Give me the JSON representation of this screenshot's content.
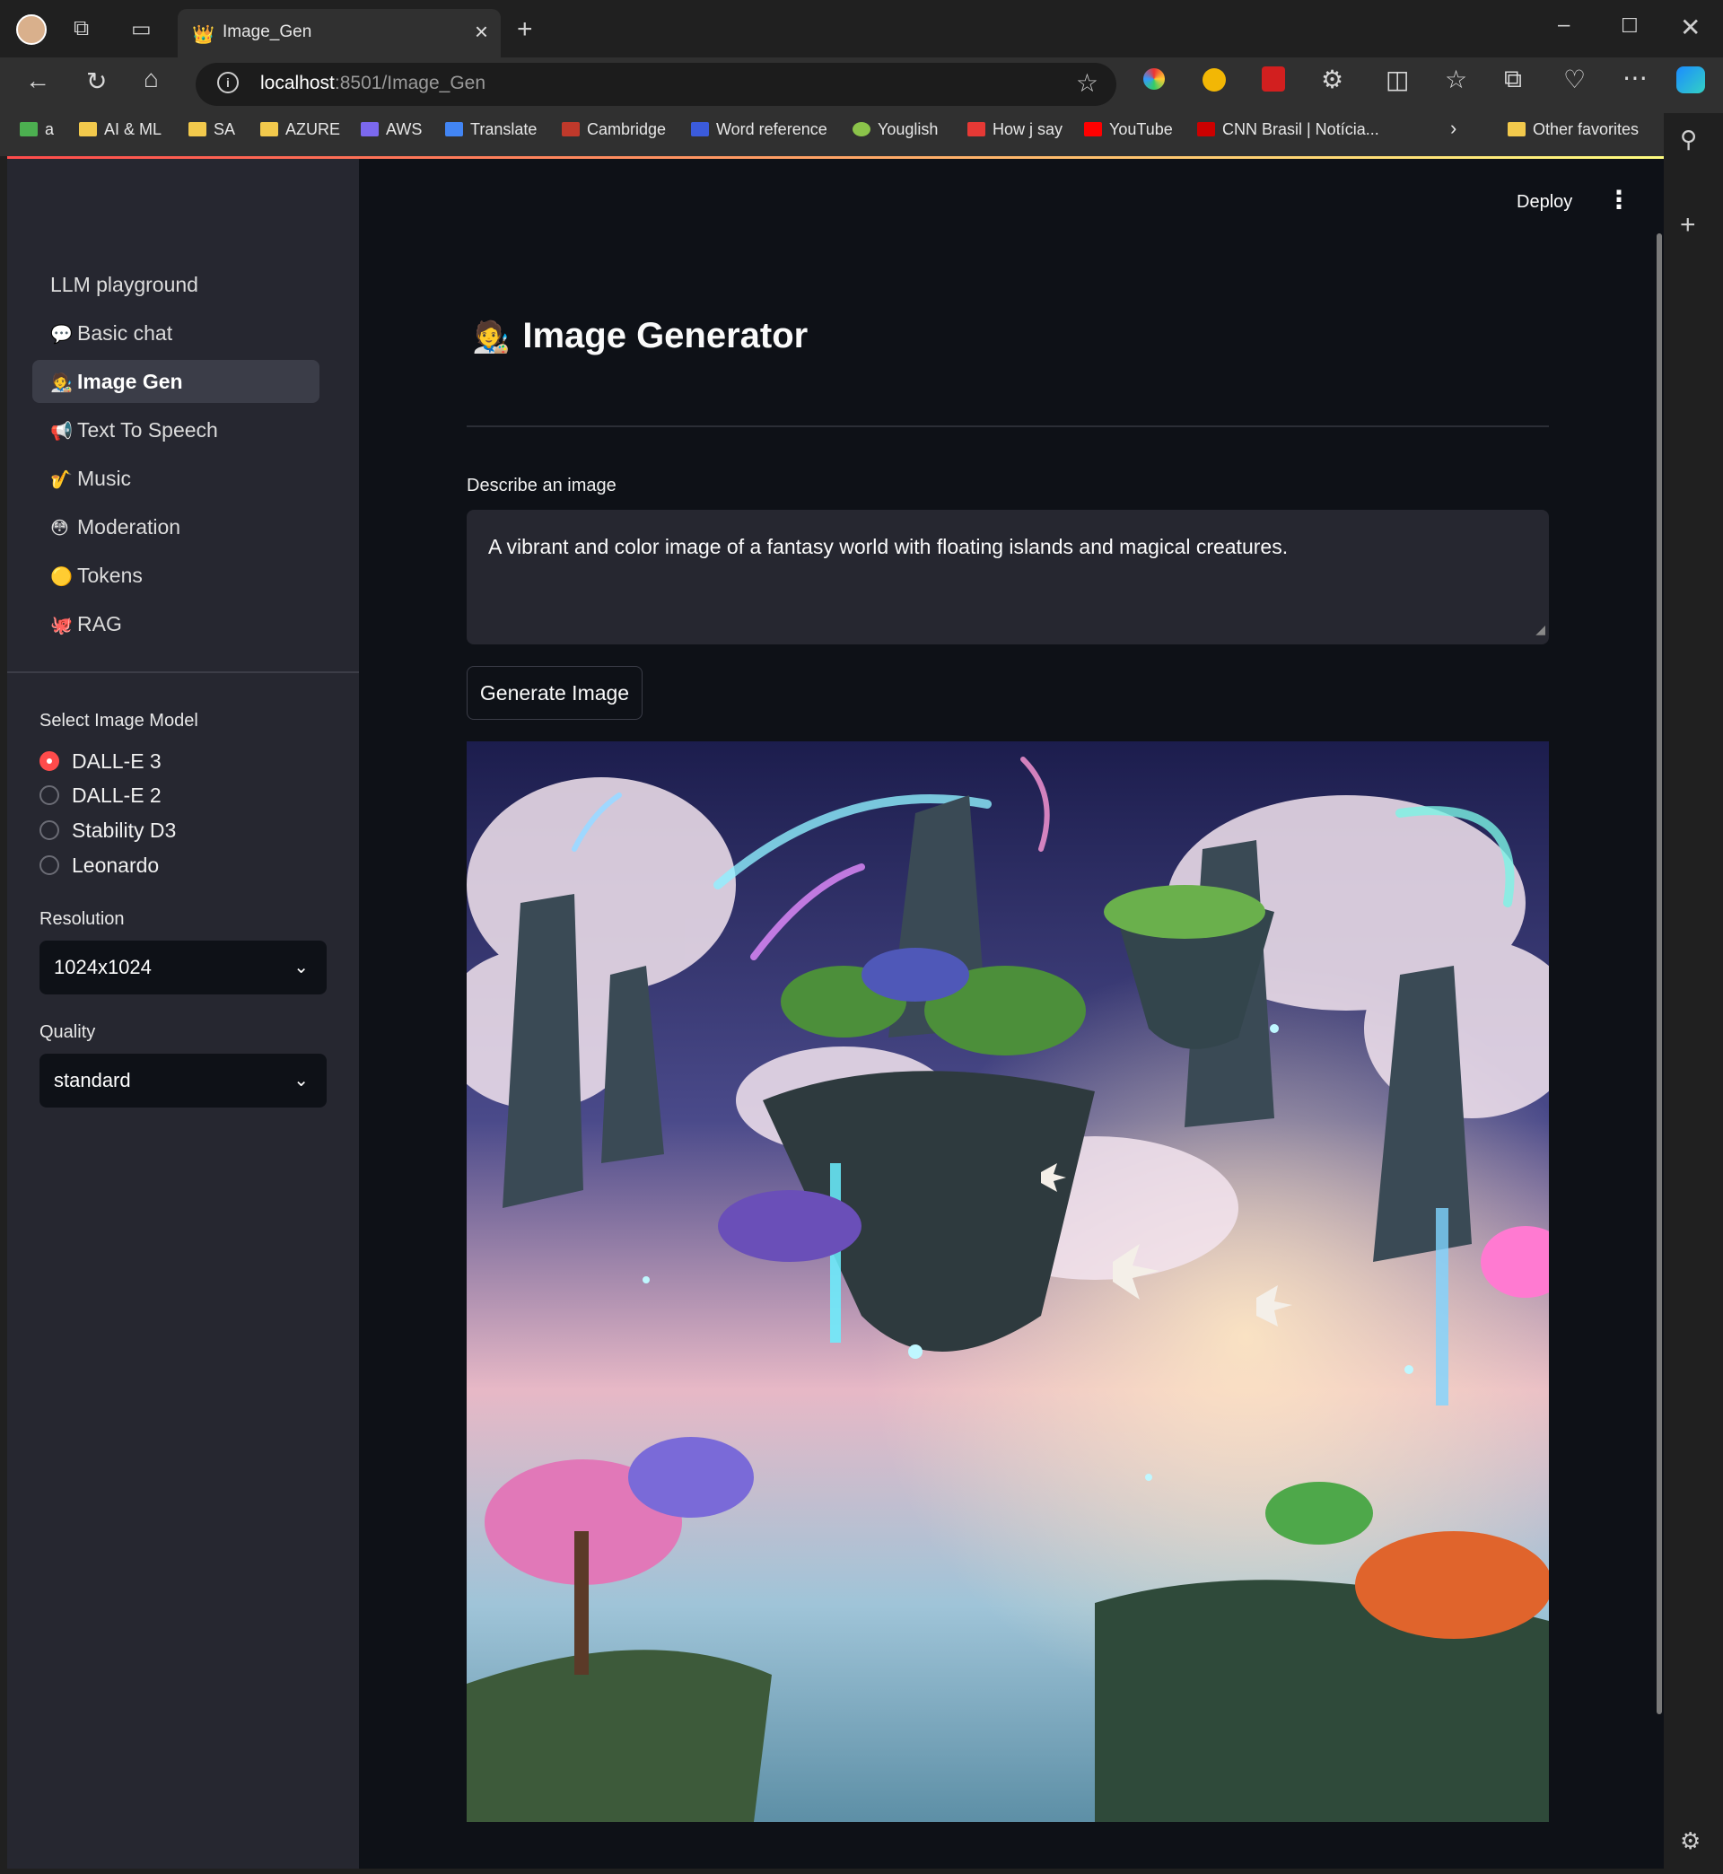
{
  "browser": {
    "tab_title": "Image_Gen",
    "url_host": "localhost",
    "url_path": ":8501/Image_Gen",
    "bookmarks": [
      {
        "label": "a"
      },
      {
        "label": "AI & ML"
      },
      {
        "label": "SA"
      },
      {
        "label": "AZURE"
      },
      {
        "label": "AWS"
      },
      {
        "label": "Translate"
      },
      {
        "label": "Cambridge"
      },
      {
        "label": "Word reference"
      },
      {
        "label": "Youglish"
      },
      {
        "label": "How j say"
      },
      {
        "label": "YouTube"
      },
      {
        "label": "CNN Brasil | Notícia..."
      }
    ],
    "other_favorites": "Other favorites"
  },
  "sidebar": {
    "nav": [
      {
        "label": "LLM playground",
        "emoji": ""
      },
      {
        "label": "Basic chat",
        "emoji": "💬"
      },
      {
        "label": "Image Gen",
        "emoji": "🧑‍🎨"
      },
      {
        "label": "Text To Speech",
        "emoji": "📢"
      },
      {
        "label": "Music",
        "emoji": "🎷"
      },
      {
        "label": "Moderation",
        "emoji": "😳"
      },
      {
        "label": "Tokens",
        "emoji": "🟡"
      },
      {
        "label": "RAG",
        "emoji": "🐙"
      }
    ],
    "model_label": "Select Image Model",
    "models": [
      "DALL-E 3",
      "DALL-E 2",
      "Stability D3",
      "Leonardo"
    ],
    "selected_model": "DALL-E 3",
    "resolution_label": "Resolution",
    "resolution_value": "1024x1024",
    "quality_label": "Quality",
    "quality_value": "standard"
  },
  "main": {
    "deploy_label": "Deploy",
    "title_emoji": "🧑‍🎨",
    "title": "Image Generator",
    "prompt_label": "Describe an image",
    "prompt_value": "A vibrant and color image of a fantasy world with floating islands and magical creatures.",
    "generate_label": "Generate Image"
  },
  "colors": {
    "accent": "#ff4b4b",
    "app_bg": "#0e1117",
    "sidebar_bg": "#262730"
  }
}
